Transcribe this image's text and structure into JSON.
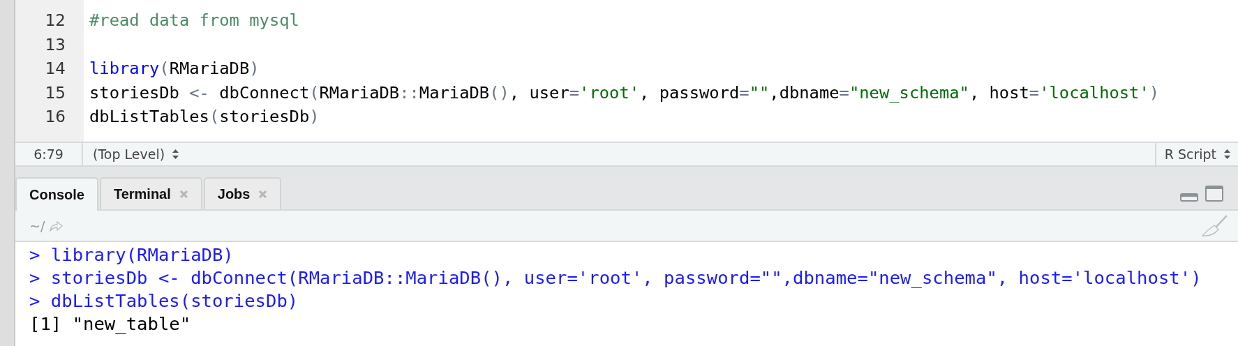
{
  "editor": {
    "lines": [
      {
        "number": "12",
        "tokens": [
          {
            "kind": "comment",
            "text": "#read data from mysql"
          }
        ]
      },
      {
        "number": "13"
      },
      {
        "number": "14",
        "tokens": [
          {
            "kind": "keyword",
            "text": "library"
          },
          {
            "kind": "op",
            "text": "("
          },
          {
            "kind": "plain",
            "text": "RMariaDB"
          },
          {
            "kind": "op",
            "text": ")"
          }
        ]
      },
      {
        "number": "15",
        "tokens": [
          {
            "kind": "plain",
            "text": "storiesDb "
          },
          {
            "kind": "op",
            "text": "<-"
          },
          {
            "kind": "plain",
            "text": " dbConnect"
          },
          {
            "kind": "op",
            "text": "("
          },
          {
            "kind": "plain",
            "text": "RMariaDB"
          },
          {
            "kind": "op",
            "text": "::"
          },
          {
            "kind": "plain",
            "text": "MariaDB"
          },
          {
            "kind": "op",
            "text": "()"
          },
          {
            "kind": "plain",
            "text": ", user"
          },
          {
            "kind": "op",
            "text": "="
          },
          {
            "kind": "string",
            "text": "'root'"
          },
          {
            "kind": "plain",
            "text": ", password"
          },
          {
            "kind": "op",
            "text": "="
          },
          {
            "kind": "string",
            "text": "\"\""
          },
          {
            "kind": "plain",
            "text": ",dbname"
          },
          {
            "kind": "op",
            "text": "="
          },
          {
            "kind": "string",
            "text": "\"new_schema\""
          },
          {
            "kind": "plain",
            "text": ", host"
          },
          {
            "kind": "op",
            "text": "="
          },
          {
            "kind": "string",
            "text": "'localhost'"
          },
          {
            "kind": "op",
            "text": ")"
          }
        ]
      },
      {
        "number": "16",
        "tokens": [
          {
            "kind": "plain",
            "text": "dbListTables"
          },
          {
            "kind": "op",
            "text": "("
          },
          {
            "kind": "plain",
            "text": "storiesDb"
          },
          {
            "kind": "op",
            "text": ")"
          }
        ]
      }
    ]
  },
  "status_bar": {
    "position": "6:79",
    "scope": "(Top Level)",
    "file_type": "R Script"
  },
  "tabs": [
    {
      "label": "Console",
      "selected": true,
      "closable": false
    },
    {
      "label": "Terminal",
      "selected": false,
      "closable": true
    },
    {
      "label": "Jobs",
      "selected": false,
      "closable": true
    }
  ],
  "console": {
    "path": "~/",
    "lines": [
      {
        "kind": "input",
        "text": "> library(RMariaDB)"
      },
      {
        "kind": "input",
        "text": "> storiesDb <- dbConnect(RMariaDB::MariaDB(), user='root', password=\"\",dbname=\"new_schema\", host='localhost')"
      },
      {
        "kind": "input",
        "text": "> dbListTables(storiesDb)"
      },
      {
        "kind": "output",
        "text": "[1] \"new_table\""
      }
    ]
  }
}
